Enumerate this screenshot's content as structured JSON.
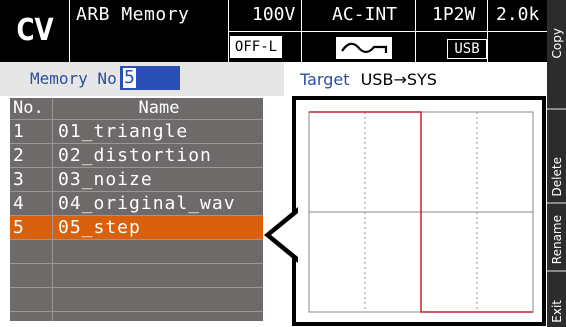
{
  "header": {
    "mode": "CV",
    "function_title": "ARB Memory",
    "voltage_range": "100V",
    "output_mode": "AC-INT",
    "phase": "1P2W",
    "frequency_range": "2.0k",
    "off_state": "OFF-L",
    "waveform_icon": "sine-wave-icon",
    "interface": "USB"
  },
  "memory": {
    "label": "Memory No.",
    "value": "5"
  },
  "list": {
    "col_no": "No.",
    "col_name": "Name",
    "items": [
      {
        "no": "1",
        "name": "01_triangle"
      },
      {
        "no": "2",
        "name": "02_distortion"
      },
      {
        "no": "3",
        "name": "03_noize"
      },
      {
        "no": "4",
        "name": "04_original_wav"
      },
      {
        "no": "5",
        "name": "05_step"
      }
    ],
    "selected_index": 4
  },
  "target": {
    "label": "Target",
    "value": "USB→SYS"
  },
  "preview_wave": {
    "shape": "step",
    "color": "#c0262d"
  },
  "softkeys": [
    "Copy",
    "Delete",
    "Rename",
    "Exit"
  ]
}
